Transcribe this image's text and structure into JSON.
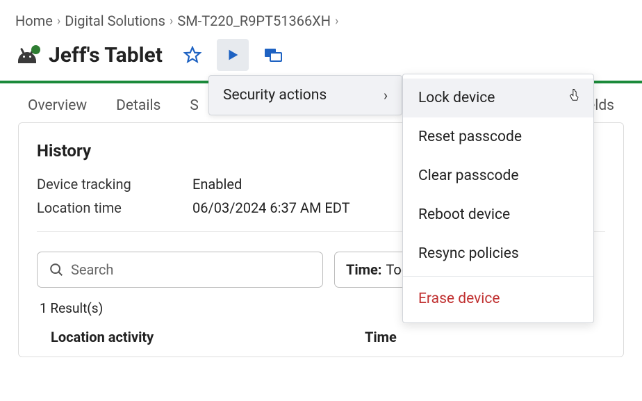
{
  "breadcrumb": {
    "items": [
      "Home",
      "Digital Solutions",
      "SM-T220_R9PT51366XH"
    ]
  },
  "title": "Jeff's Tablet",
  "tabs": {
    "t0": "Overview",
    "t1": "Details",
    "t2_partial": "S",
    "t_last": "Fields"
  },
  "history": {
    "heading": "History",
    "tracking_label": "Device tracking",
    "tracking_value": "Enabled",
    "location_label": "Location time",
    "location_value": "06/03/2024 6:37 AM EDT"
  },
  "search": {
    "placeholder": "Search"
  },
  "time_filter": {
    "label": "Time:",
    "value": "Today"
  },
  "results": {
    "count_text": "1 Result(s)",
    "col1": "Location activity",
    "col2": "Time"
  },
  "menu": {
    "parent": "Security actions",
    "items": {
      "lock": "Lock device",
      "reset": "Reset passcode",
      "clear": "Clear passcode",
      "reboot": "Reboot device",
      "resync": "Resync policies",
      "erase": "Erase device"
    }
  }
}
